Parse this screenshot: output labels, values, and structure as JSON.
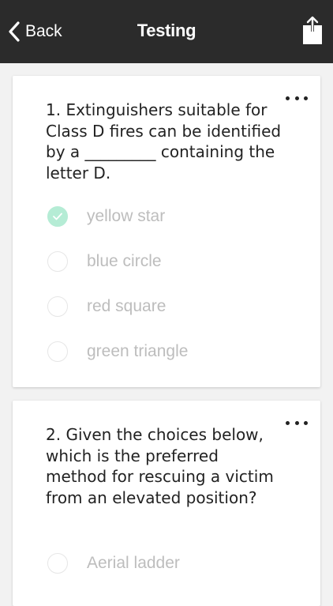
{
  "nav": {
    "back_label": "Back",
    "title": "Testing",
    "background": "#2b2b2b"
  },
  "questions": [
    {
      "text": "1. Extinguishers suitable for Class D fires can be identified by a _________ containing the letter D.",
      "options": [
        {
          "label": "yellow star",
          "selected": true
        },
        {
          "label": "blue circle",
          "selected": false
        },
        {
          "label": "red square",
          "selected": false
        },
        {
          "label": "green triangle",
          "selected": false
        }
      ]
    },
    {
      "text": "2. Given the choices below, which is the preferred method for rescuing a victim from an elevated position?",
      "options": [
        {
          "label": "Aerial ladder",
          "selected": false
        }
      ]
    }
  ],
  "colors": {
    "selected_radio": "#b5ecd5",
    "option_text": "#bdbdbd",
    "question_text": "#222222"
  },
  "icons": {
    "back": "chevron-left-icon",
    "share": "share-icon",
    "more": "more-horizontal-icon",
    "check": "check-icon"
  }
}
